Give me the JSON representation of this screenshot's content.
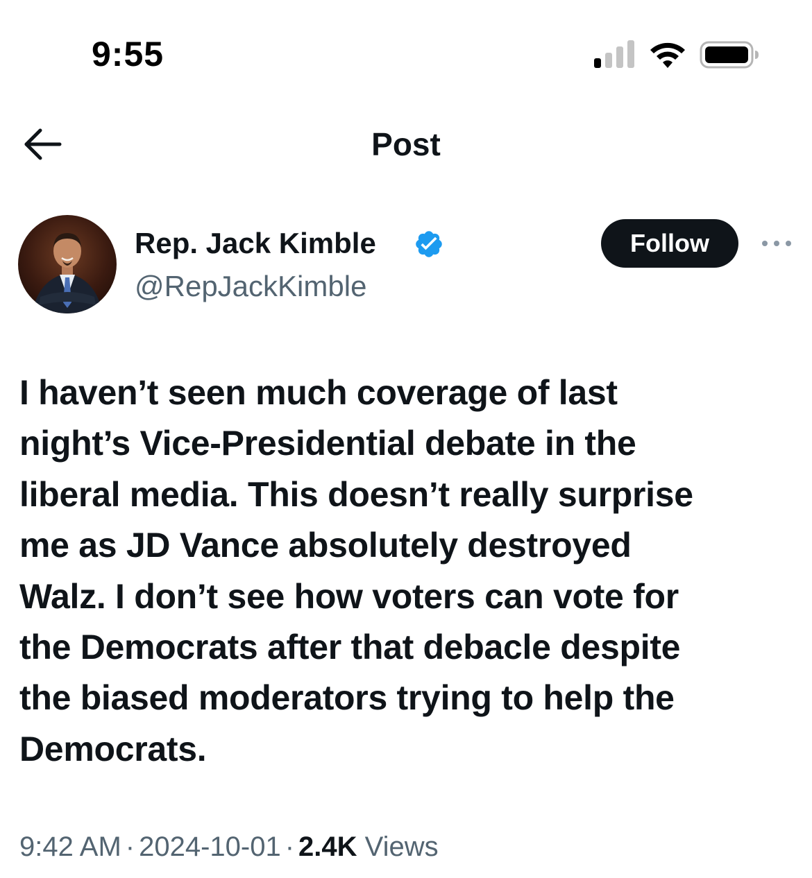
{
  "status_bar": {
    "time": "9:55",
    "icons": [
      "cellular-signal-icon",
      "wifi-icon",
      "battery-icon"
    ]
  },
  "header": {
    "title": "Post",
    "back_icon": "arrow-left-icon"
  },
  "author": {
    "name": "Rep. Jack Kimble",
    "handle": "@RepJackKimble",
    "verified": true,
    "verified_color": "#1d9bf0"
  },
  "actions": {
    "follow_label": "Follow",
    "more_icon": "more-horizontal-icon"
  },
  "post": {
    "lines": [
      "I haven’t seen much coverage of last",
      "night’s Vice-Presidential debate in the",
      "liberal media. This doesn’t really surprise",
      "me as JD Vance absolutely destroyed",
      "Walz. I don’t see how voters can vote for",
      "the Democrats after that debacle despite",
      "the biased moderators trying to help the",
      "Democrats."
    ],
    "time": "9:42 AM",
    "date": "2024-10-01",
    "separator": "·",
    "views_count": "2.4K",
    "views_label": "Views"
  },
  "colors": {
    "text_primary": "#0f1419",
    "text_secondary": "#536471",
    "follow_bg": "#0f1419",
    "follow_text": "#ffffff"
  }
}
